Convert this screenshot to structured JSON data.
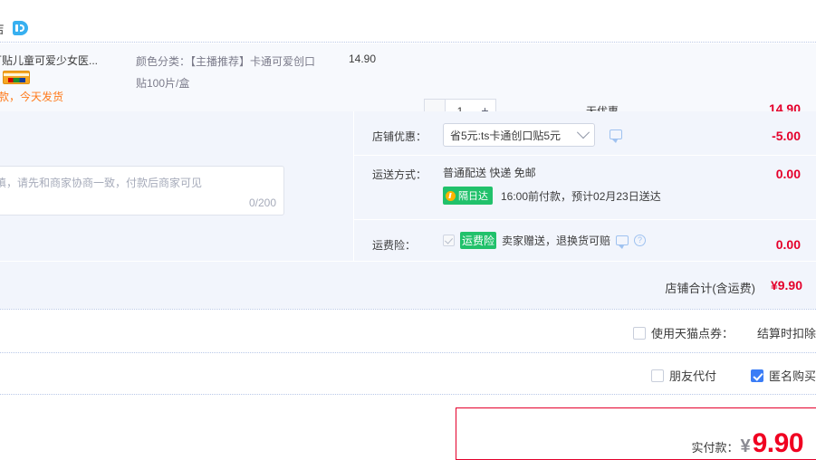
{
  "shop": {
    "name": "舰店",
    "badge_icon": "tmall-cat-icon"
  },
  "product": {
    "title": "通创可贴儿童可爱少女医...",
    "sku": "颜色分类：【主播推荐】卡通可爱创口贴100片/盒",
    "unit_price": "14.90",
    "ship_note": "前付款，今天发货",
    "badge_icons": [
      "green-tag-icon",
      "installment-card-icon"
    ],
    "quantity": "1",
    "minus_label": "—",
    "plus_label": "+",
    "promo_text": "无优惠",
    "row_total": "14.90"
  },
  "message": {
    "placeholder": "选填，请先和商家协商一致，付款后商家可见",
    "counter": "0/200"
  },
  "rows": [
    {
      "label": "店铺优惠：",
      "select_value": "省5元:ts卡通创口贴5元",
      "chevron_icon": "chevron-down-icon",
      "bubble_icon": "comment-bubble-icon",
      "amount": "-5.00"
    },
    {
      "label": "运送方式：",
      "shipping_method": "普通配送 快递 免邮",
      "speed_badge": "隔日达",
      "speed_badge_icon": "lightning-icon",
      "eta": "16:00前付款，预计02月23日送达",
      "amount": "0.00"
    },
    {
      "label": "运费险：",
      "checkbox_checked": true,
      "tag": "运费险",
      "text": "卖家赠送，退换货可赔",
      "bubble_icon": "comment-bubble-icon",
      "help_icon": "question-mark-icon",
      "amount": "0.00"
    }
  ],
  "shop_total": {
    "label": "店铺合计(含运费)",
    "value": "¥9.90"
  },
  "options": {
    "coupon": {
      "label": "使用天猫点券：",
      "checked": false,
      "note": "结算时扣除"
    },
    "friend_pay": {
      "label": "朋友代付",
      "checked": false
    },
    "anonymous": {
      "label": "匿名购买",
      "checked": true
    }
  },
  "payment": {
    "label": "实付款：",
    "currency": "¥",
    "amount": "9.90"
  },
  "colors": {
    "accent_red": "#e4002b",
    "pay_red": "#f00021",
    "band_bg": "#f2f5fc",
    "item_bg": "#f7f9fd",
    "green": "#21c16b",
    "blue": "#3b7df6",
    "orange": "#ff7a1a"
  }
}
